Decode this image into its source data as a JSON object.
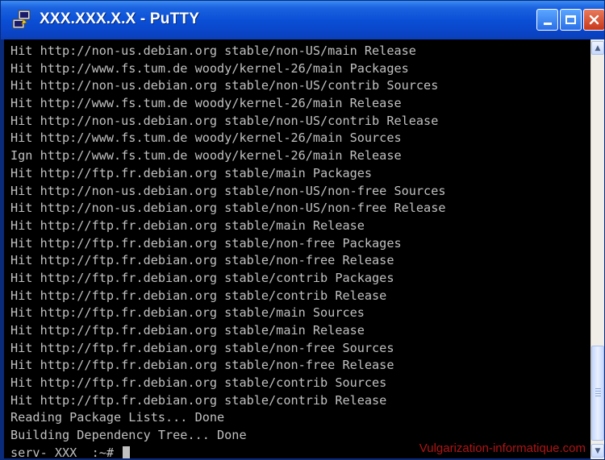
{
  "window": {
    "title_host": "XXX.XXX.X.X",
    "title_sep": " - ",
    "title_app": "PuTTY",
    "icon": "putty-app-icon",
    "buttons": [
      "minimize-icon",
      "maximize-icon",
      "close-icon"
    ]
  },
  "terminal": {
    "lines": [
      "Hit http://non-us.debian.org stable/non-US/main Release",
      "Hit http://www.fs.tum.de woody/kernel-26/main Packages",
      "Hit http://non-us.debian.org stable/non-US/contrib Sources",
      "Hit http://www.fs.tum.de woody/kernel-26/main Release",
      "Hit http://non-us.debian.org stable/non-US/contrib Release",
      "Hit http://www.fs.tum.de woody/kernel-26/main Sources",
      "Ign http://www.fs.tum.de woody/kernel-26/main Release",
      "Hit http://ftp.fr.debian.org stable/main Packages",
      "Hit http://non-us.debian.org stable/non-US/non-free Sources",
      "Hit http://non-us.debian.org stable/non-US/non-free Release",
      "Hit http://ftp.fr.debian.org stable/main Release",
      "Hit http://ftp.fr.debian.org stable/non-free Packages",
      "Hit http://ftp.fr.debian.org stable/non-free Release",
      "Hit http://ftp.fr.debian.org stable/contrib Packages",
      "Hit http://ftp.fr.debian.org stable/contrib Release",
      "Hit http://ftp.fr.debian.org stable/main Sources",
      "Hit http://ftp.fr.debian.org stable/main Release",
      "Hit http://ftp.fr.debian.org stable/non-free Sources",
      "Hit http://ftp.fr.debian.org stable/non-free Release",
      "Hit http://ftp.fr.debian.org stable/contrib Sources",
      "Hit http://ftp.fr.debian.org stable/contrib Release",
      "Reading Package Lists... Done",
      "Building Dependency Tree... Done"
    ],
    "prompt": "serv- XXX  :~# ",
    "watermark": "Vulgarization-informatique.com"
  },
  "colors": {
    "terminal_bg": "#000000",
    "terminal_fg": "#c0c0c0",
    "titlebar": "#0a4fd6",
    "watermark": "#b01414"
  }
}
